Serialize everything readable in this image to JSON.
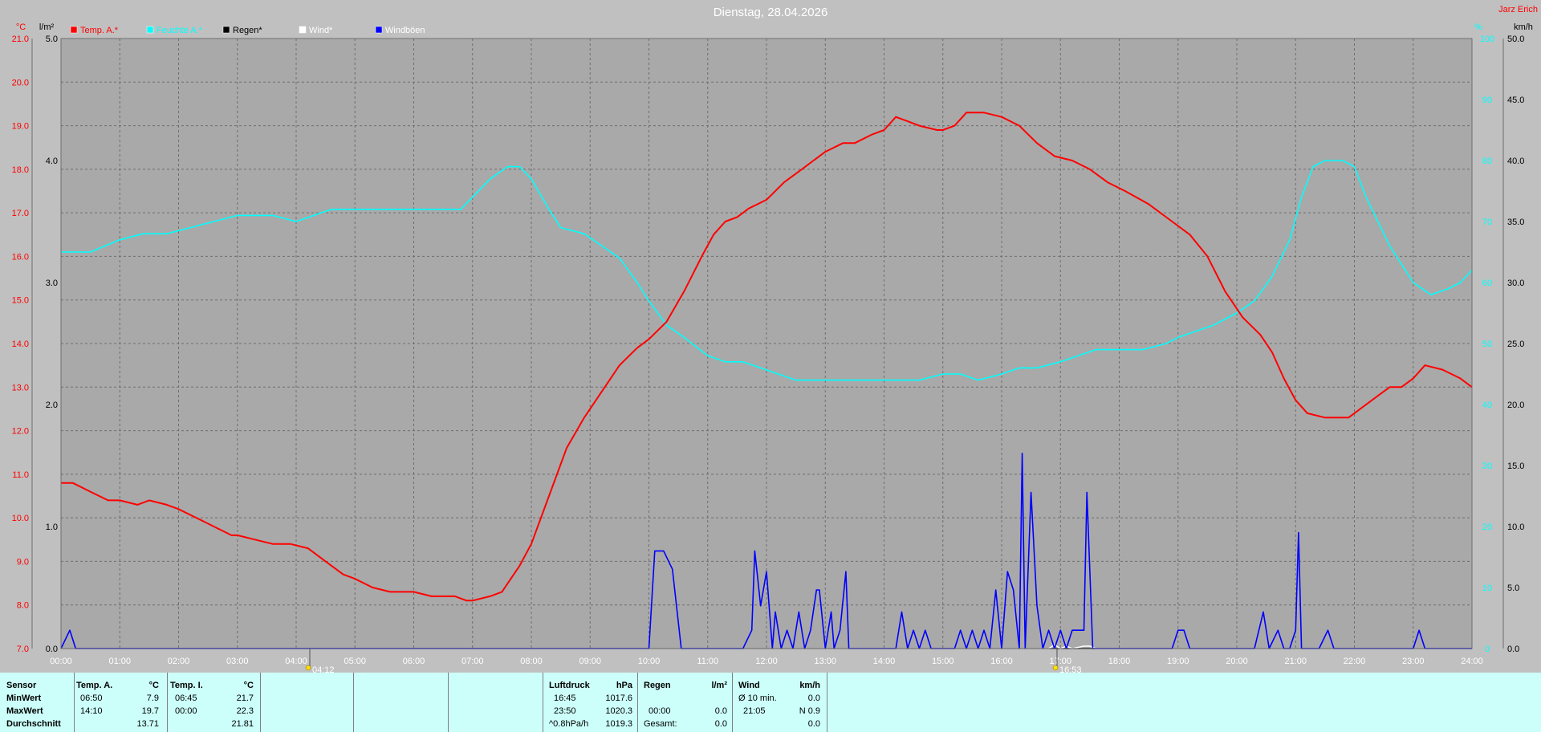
{
  "title": "Dienstag, 28.04.2026",
  "brand": "Jarz Erich",
  "markers": {
    "sunrise": "04:12",
    "sunset": "16:53"
  },
  "colors": {
    "bg": "#c0c0c0",
    "plot": "#a9a9a9",
    "grid": "#6e6e6e",
    "temp": "#ff0000",
    "humidity": "#00ffff",
    "rain": "#000000",
    "wind": "#ffffff",
    "gust": "#0000ff",
    "stats_bg": "#ccfffa"
  },
  "chart_data": {
    "type": "line",
    "title": "Dienstag, 28.04.2026",
    "legend": [
      "Temp. A.*",
      "Feuchte A.*",
      "Regen*",
      "Wind*",
      "Windböen"
    ],
    "x_ticks": [
      "00:00",
      "01:00",
      "02:00",
      "03:00",
      "04:00",
      "05:00",
      "06:00",
      "07:00",
      "08:00",
      "09:00",
      "10:00",
      "11:00",
      "12:00",
      "13:00",
      "14:00",
      "15:00",
      "16:00",
      "17:00",
      "18:00",
      "19:00",
      "20:00",
      "21:00",
      "22:00",
      "23:00",
      "24:00"
    ],
    "axes": {
      "temp": {
        "unit": "°C",
        "range": [
          7,
          21
        ],
        "ticks": [
          "21.0",
          "20.0",
          "19.0",
          "18.0",
          "17.0",
          "16.0",
          "15.0",
          "14.0",
          "13.0",
          "12.0",
          "11.0",
          "10.0",
          "9.0",
          "8.0",
          "7.0"
        ]
      },
      "rain": {
        "unit": "l/m²",
        "range": [
          0,
          5
        ],
        "ticks": [
          "5.0",
          "4.0",
          "3.0",
          "2.0",
          "1.0",
          "0.0"
        ]
      },
      "humidity": {
        "unit": "%",
        "range": [
          0,
          100
        ],
        "ticks": [
          "100",
          "90",
          "80",
          "70",
          "60",
          "50",
          "40",
          "30",
          "20",
          "10",
          "0"
        ]
      },
      "wind": {
        "unit": "km/h",
        "range": [
          0,
          50
        ],
        "ticks": [
          "50.0",
          "45.0",
          "40.0",
          "35.0",
          "30.0",
          "25.0",
          "20.0",
          "15.0",
          "10.0",
          "5.0",
          "0.0"
        ]
      }
    },
    "series": [
      {
        "name": "Temp. A.*",
        "axis": "temp",
        "color": "#ff0000",
        "x": [
          0,
          0.2,
          0.5,
          0.8,
          1,
          1.3,
          1.5,
          1.8,
          2,
          2.3,
          2.6,
          2.9,
          3,
          3.3,
          3.6,
          3.9,
          4.2,
          4.5,
          4.8,
          5,
          5.3,
          5.6,
          6,
          6.3,
          6.7,
          6.9,
          7,
          7.3,
          7.5,
          7.8,
          8,
          8.3,
          8.6,
          8.9,
          9.2,
          9.5,
          9.8,
          10,
          10.3,
          10.6,
          10.9,
          11.1,
          11.3,
          11.5,
          11.7,
          12,
          12.3,
          12.6,
          12.8,
          13,
          13.3,
          13.5,
          13.8,
          14,
          14.2,
          14.4,
          14.6,
          14.9,
          15,
          15.2,
          15.4,
          15.7,
          16,
          16.3,
          16.6,
          16.9,
          17.2,
          17.5,
          17.8,
          18.1,
          18.5,
          18.9,
          19.2,
          19.5,
          19.8,
          20.1,
          20.4,
          20.6,
          20.8,
          21,
          21.2,
          21.5,
          21.7,
          21.9,
          22.1,
          22.4,
          22.6,
          22.8,
          23,
          23.2,
          23.5,
          23.8,
          24
        ],
        "values": [
          10.8,
          10.8,
          10.6,
          10.4,
          10.4,
          10.3,
          10.4,
          10.3,
          10.2,
          10,
          9.8,
          9.6,
          9.6,
          9.5,
          9.4,
          9.4,
          9.3,
          9.0,
          8.7,
          8.6,
          8.4,
          8.3,
          8.3,
          8.2,
          8.2,
          8.1,
          8.1,
          8.2,
          8.3,
          8.9,
          9.4,
          10.5,
          11.6,
          12.3,
          12.9,
          13.5,
          13.9,
          14.1,
          14.5,
          15.2,
          16.0,
          16.5,
          16.8,
          16.9,
          17.1,
          17.3,
          17.7,
          18.0,
          18.2,
          18.4,
          18.6,
          18.6,
          18.8,
          18.9,
          19.2,
          19.1,
          19.0,
          18.9,
          18.9,
          19.0,
          19.3,
          19.3,
          19.2,
          19.0,
          18.6,
          18.3,
          18.2,
          18.0,
          17.7,
          17.5,
          17.2,
          16.8,
          16.5,
          16.0,
          15.2,
          14.6,
          14.2,
          13.8,
          13.2,
          12.7,
          12.4,
          12.3,
          12.3,
          12.3,
          12.5,
          12.8,
          13.0,
          13.0,
          13.2,
          13.5,
          13.4,
          13.2,
          13.0
        ]
      },
      {
        "name": "Feuchte A.*",
        "axis": "humidity",
        "color": "#00ffff",
        "x": [
          0,
          0.5,
          1,
          1.4,
          1.8,
          2.2,
          2.6,
          3,
          3.3,
          3.6,
          4,
          4.3,
          4.6,
          5,
          5.5,
          6,
          6.4,
          6.8,
          7,
          7.3,
          7.6,
          7.8,
          8,
          8.3,
          8.5,
          8.9,
          9.2,
          9.5,
          9.8,
          10,
          10.3,
          10.6,
          11,
          11.3,
          11.6,
          11.9,
          12.2,
          12.5,
          12.8,
          13,
          13.3,
          13.6,
          14,
          14.3,
          14.6,
          15,
          15.3,
          15.6,
          16,
          16.3,
          16.6,
          17,
          17.3,
          17.6,
          18,
          18.4,
          18.8,
          19,
          19.3,
          19.6,
          20,
          20.3,
          20.6,
          20.9,
          21.1,
          21.3,
          21.5,
          21.8,
          22,
          22.2,
          22.4,
          22.6,
          22.8,
          23,
          23.3,
          23.6,
          23.8,
          24
        ],
        "values": [
          65,
          65,
          67,
          68,
          68,
          69,
          70,
          71,
          71,
          71,
          70,
          71,
          72,
          72,
          72,
          72,
          72,
          72,
          74,
          77,
          79,
          79,
          77,
          72,
          69,
          68,
          66,
          64,
          60,
          57,
          53,
          51,
          48,
          47,
          47,
          46,
          45,
          44,
          44,
          44,
          44,
          44,
          44,
          44,
          44,
          45,
          45,
          44,
          45,
          46,
          46,
          47,
          48,
          49,
          49,
          49,
          50,
          51,
          52,
          53,
          55,
          57,
          61,
          67,
          74,
          79,
          80,
          80,
          79,
          74,
          70,
          66,
          63,
          60,
          58,
          59,
          60,
          62
        ]
      },
      {
        "name": "Regen*",
        "axis": "rain",
        "color": "#000000",
        "x": [
          0,
          24
        ],
        "values": [
          0,
          0
        ]
      },
      {
        "name": "Wind*",
        "axis": "wind",
        "color": "#ffffff",
        "x": [
          0,
          16.8,
          16.9,
          17.0,
          17.1,
          17.2,
          17.4,
          17.5,
          17.6,
          18.0,
          24
        ],
        "values": [
          0,
          0,
          0.3,
          0,
          0.2,
          0,
          0.2,
          0.2,
          0,
          0,
          0
        ]
      },
      {
        "name": "Windböen",
        "axis": "wind",
        "color": "#0000ff",
        "x": [
          0,
          0.15,
          0.25,
          0.35,
          10,
          10.1,
          10.25,
          10.4,
          10.55,
          11.6,
          11.75,
          11.8,
          11.9,
          12.0,
          12.1,
          12.15,
          12.25,
          12.35,
          12.45,
          12.55,
          12.65,
          12.75,
          12.85,
          12.9,
          13.0,
          13.1,
          13.15,
          13.25,
          13.35,
          13.4,
          13.5,
          13.6,
          13.7,
          13.75,
          14.2,
          14.3,
          14.4,
          14.5,
          14.6,
          14.7,
          14.8,
          14.9,
          15.2,
          15.3,
          15.4,
          15.5,
          15.6,
          15.7,
          15.8,
          15.9,
          16.0,
          16.1,
          16.2,
          16.3,
          16.35,
          16.4,
          16.5,
          16.6,
          16.7,
          16.8,
          16.9,
          17.0,
          17.1,
          17.2,
          17.3,
          17.4,
          17.45,
          17.55,
          17.6,
          18.9,
          19.0,
          19.1,
          19.2,
          20.3,
          20.45,
          20.55,
          20.7,
          20.8,
          20.9,
          21.0,
          21.05,
          21.1,
          21.2,
          21.4,
          21.55,
          21.65,
          23.0,
          23.1,
          23.2,
          24
        ],
        "values": [
          0,
          1.5,
          0,
          0,
          0,
          8,
          8,
          6.5,
          0,
          0,
          1.5,
          8,
          3.5,
          6.3,
          0,
          3,
          0,
          1.5,
          0,
          3,
          0,
          1.5,
          4.8,
          4.8,
          0,
          3,
          0,
          1.5,
          6.3,
          0,
          0,
          0,
          0,
          0,
          0,
          3,
          0,
          1.5,
          0,
          1.5,
          0,
          0,
          0,
          1.5,
          0,
          1.5,
          0,
          1.5,
          0,
          4.8,
          0,
          6.3,
          4.8,
          0,
          16,
          0,
          12.8,
          3.5,
          0,
          1.5,
          0,
          1.5,
          0,
          1.5,
          1.5,
          1.5,
          12.8,
          0,
          0,
          0,
          1.5,
          1.5,
          0,
          0,
          3,
          0,
          1.5,
          0,
          0,
          1.5,
          9.5,
          0,
          0,
          0,
          1.5,
          0,
          0,
          1.5,
          0,
          0
        ]
      }
    ]
  },
  "stats": {
    "row_labels": [
      "Sensor",
      "MinWert",
      "MaxWert",
      "Durchschnitt"
    ],
    "temp_a": {
      "header": "Temp. A.",
      "unit": "°C",
      "min_time": "06:50",
      "min": "7.9",
      "max_time": "14:10",
      "max": "19.7",
      "avg": "13.71"
    },
    "temp_i": {
      "header": "Temp. I.",
      "unit": "°C",
      "min_time": "06:45",
      "min": "21.7",
      "max_time": "00:00",
      "max": "22.3",
      "avg": "21.81"
    },
    "pressure": {
      "header": "Luftdruck",
      "unit": "hPa",
      "min_time": "16:45",
      "min": "1017.6",
      "max_time": "23:50",
      "max": "1020.3",
      "trend": "^0.8hPa/h",
      "avg": "1019.3"
    },
    "rain": {
      "header": "Regen",
      "unit": "l/m²",
      "max_time": "00:00",
      "max": "0.0",
      "total_label": "Gesamt:",
      "total": "0.0"
    },
    "wind": {
      "header": "Wind",
      "unit": "km/h",
      "min_label": "Ø 10 min.",
      "min": "0.0",
      "max_time": "21:05",
      "max": "N 0.9",
      "avg": "0.0"
    }
  }
}
